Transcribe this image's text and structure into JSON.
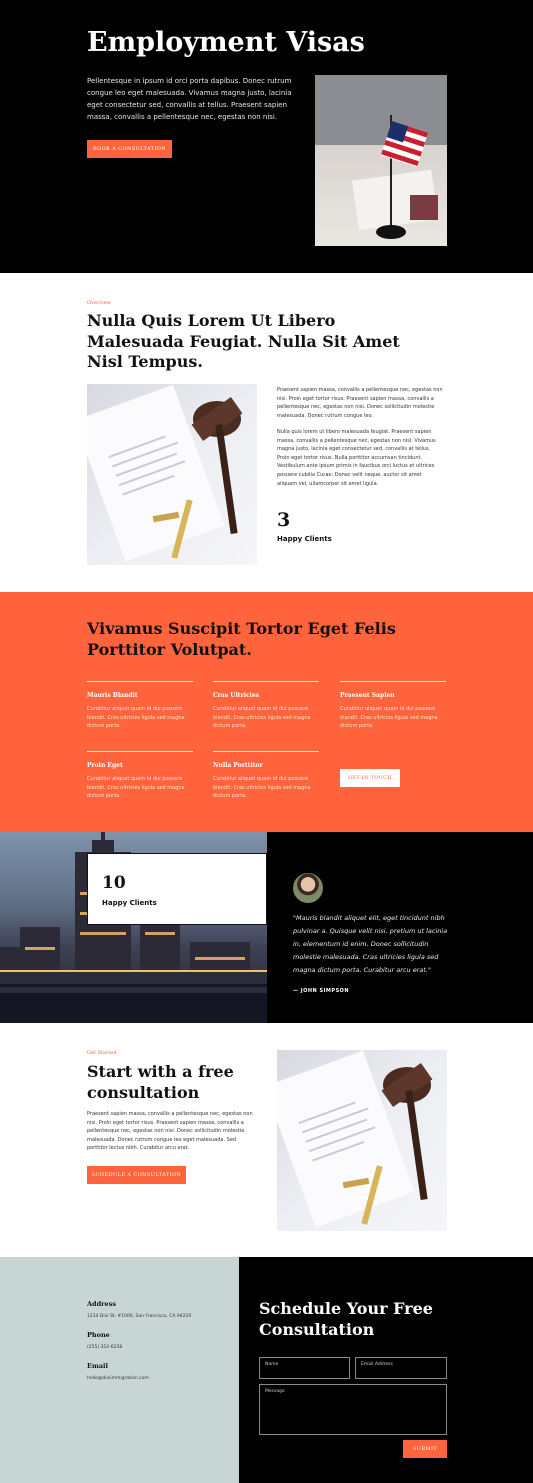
{
  "colors": {
    "accent": "#ff643c",
    "dark": "#000000",
    "contact_bg": "#c8d6d3"
  },
  "hero": {
    "title": "Employment Visas",
    "description": "Pellentesque in ipsum id orci porta dapibus. Donec rutrum congue leo eget malesuada. Vivamus magna justo, lacinia eget consectetur sed, convallis at tellus. Praesent sapien massa, convallis a pellentesque nec, egestas non nisi.",
    "cta": "BOOK A CONSULTATION",
    "photo_icon": "flag-photo"
  },
  "overview": {
    "kicker": "Overview",
    "title": "Nulla Quis Lorem Ut Libero Malesuada Feugiat. Nulla Sit Amet Nisl Tempus.",
    "paragraph1": "Praesent sapien massa, convallis a pellentesque nec, egestas non nisi. Proin eget tortor risus. Praesent sapien massa, convallis a pellentesque nec, egestas non nisi. Donec sollicitudin molestie malesuada. Donec rutrum congue leo.",
    "paragraph2": "Nulla quis lorem ut libero malesuada feugiat. Praesent sapien massa, convallis a pellentesque nec, egestas non nisi. Vivamus magna justo, lacinia eget consectetur sed, convallis at tellus. Proin eget tortor risus. Nulla porttitor accumsan tincidunt. Vestibulum ante ipsum primis in faucibus orci luctus et ultrices posuere cubilia Curae; Donec velit neque, auctor sit amet aliquam vel, ullamcorper sit amet ligula.",
    "stat_number": "3",
    "stat_label": "Happy Clients",
    "photo_icon": "gavel-photo"
  },
  "services": {
    "title": "Vivamus Suscipit Tortor Eget Felis Porttitor Volutpat.",
    "items": [
      {
        "title": "Mauris Blandit",
        "text": "Curabitur aliquet quam id dui posuere blandit. Cras ultricies ligula sed magna dictum porta."
      },
      {
        "title": "Cras Ultricies",
        "text": "Curabitur aliquet quam id dui posuere blandit. Cras ultricies ligula sed magna dictum porta."
      },
      {
        "title": "Praesent Sapien",
        "text": "Curabitur aliquet quam id dui posuere blandit. Cras ultricies ligula sed magna dictum porta."
      },
      {
        "title": "Proin Eget",
        "text": "Curabitur aliquet quam id dui posuere blandit. Cras ultricies ligula sed magna dictum porta."
      },
      {
        "title": "Nulla Porttitor",
        "text": "Curabitur aliquet quam id dui posuere blandit. Cras ultricies ligula sed magna dictum porta."
      }
    ],
    "cta": "GET IN TOUCH"
  },
  "testimonial": {
    "stat_number": "10",
    "stat_label": "Happy Clients",
    "quote": "\"Mauris blandit aliquet elit, eget tincidunt nibh pulvinar a. Quisque velit nisi, pretium ut lacinia in, elementum id enim. Donec sollicitudin molestie malesuada. Cras ultricies ligula sed magna dictum porta. Curabitur arcu erat.\"",
    "author": "— JOHN SIMPSON",
    "photo_icon": "city-skyline-photo"
  },
  "get_started": {
    "kicker": "Get Started",
    "title": "Start with a free consultation",
    "text": "Praesent sapien massa, convallis a pellentesque nec, egestas non nisi. Proin eget tortor risus. Praesent sapien massa, convallis a pellentesque nec, egestas non nisi. Donec sollicitudin molestie malesuada. Donec rutrum congue leo eget malesuada. Sed porttitor lectus nibh. Curabitur arcu erat.",
    "cta": "SCHEDULE A CONSULTATION"
  },
  "contact": {
    "address_label": "Address",
    "address_value": "1234 Divi St. #1000, San Francisco, CA 94220",
    "phone_label": "Phone",
    "phone_value": "(255) 352-6258",
    "email_label": "Email",
    "email_value": "hello@diviimmigration.com",
    "form_title": "Schedule Your Free Consultation",
    "name_placeholder": "Name",
    "email_placeholder": "Email Address",
    "message_placeholder": "Message",
    "submit": "SUBMIT"
  }
}
